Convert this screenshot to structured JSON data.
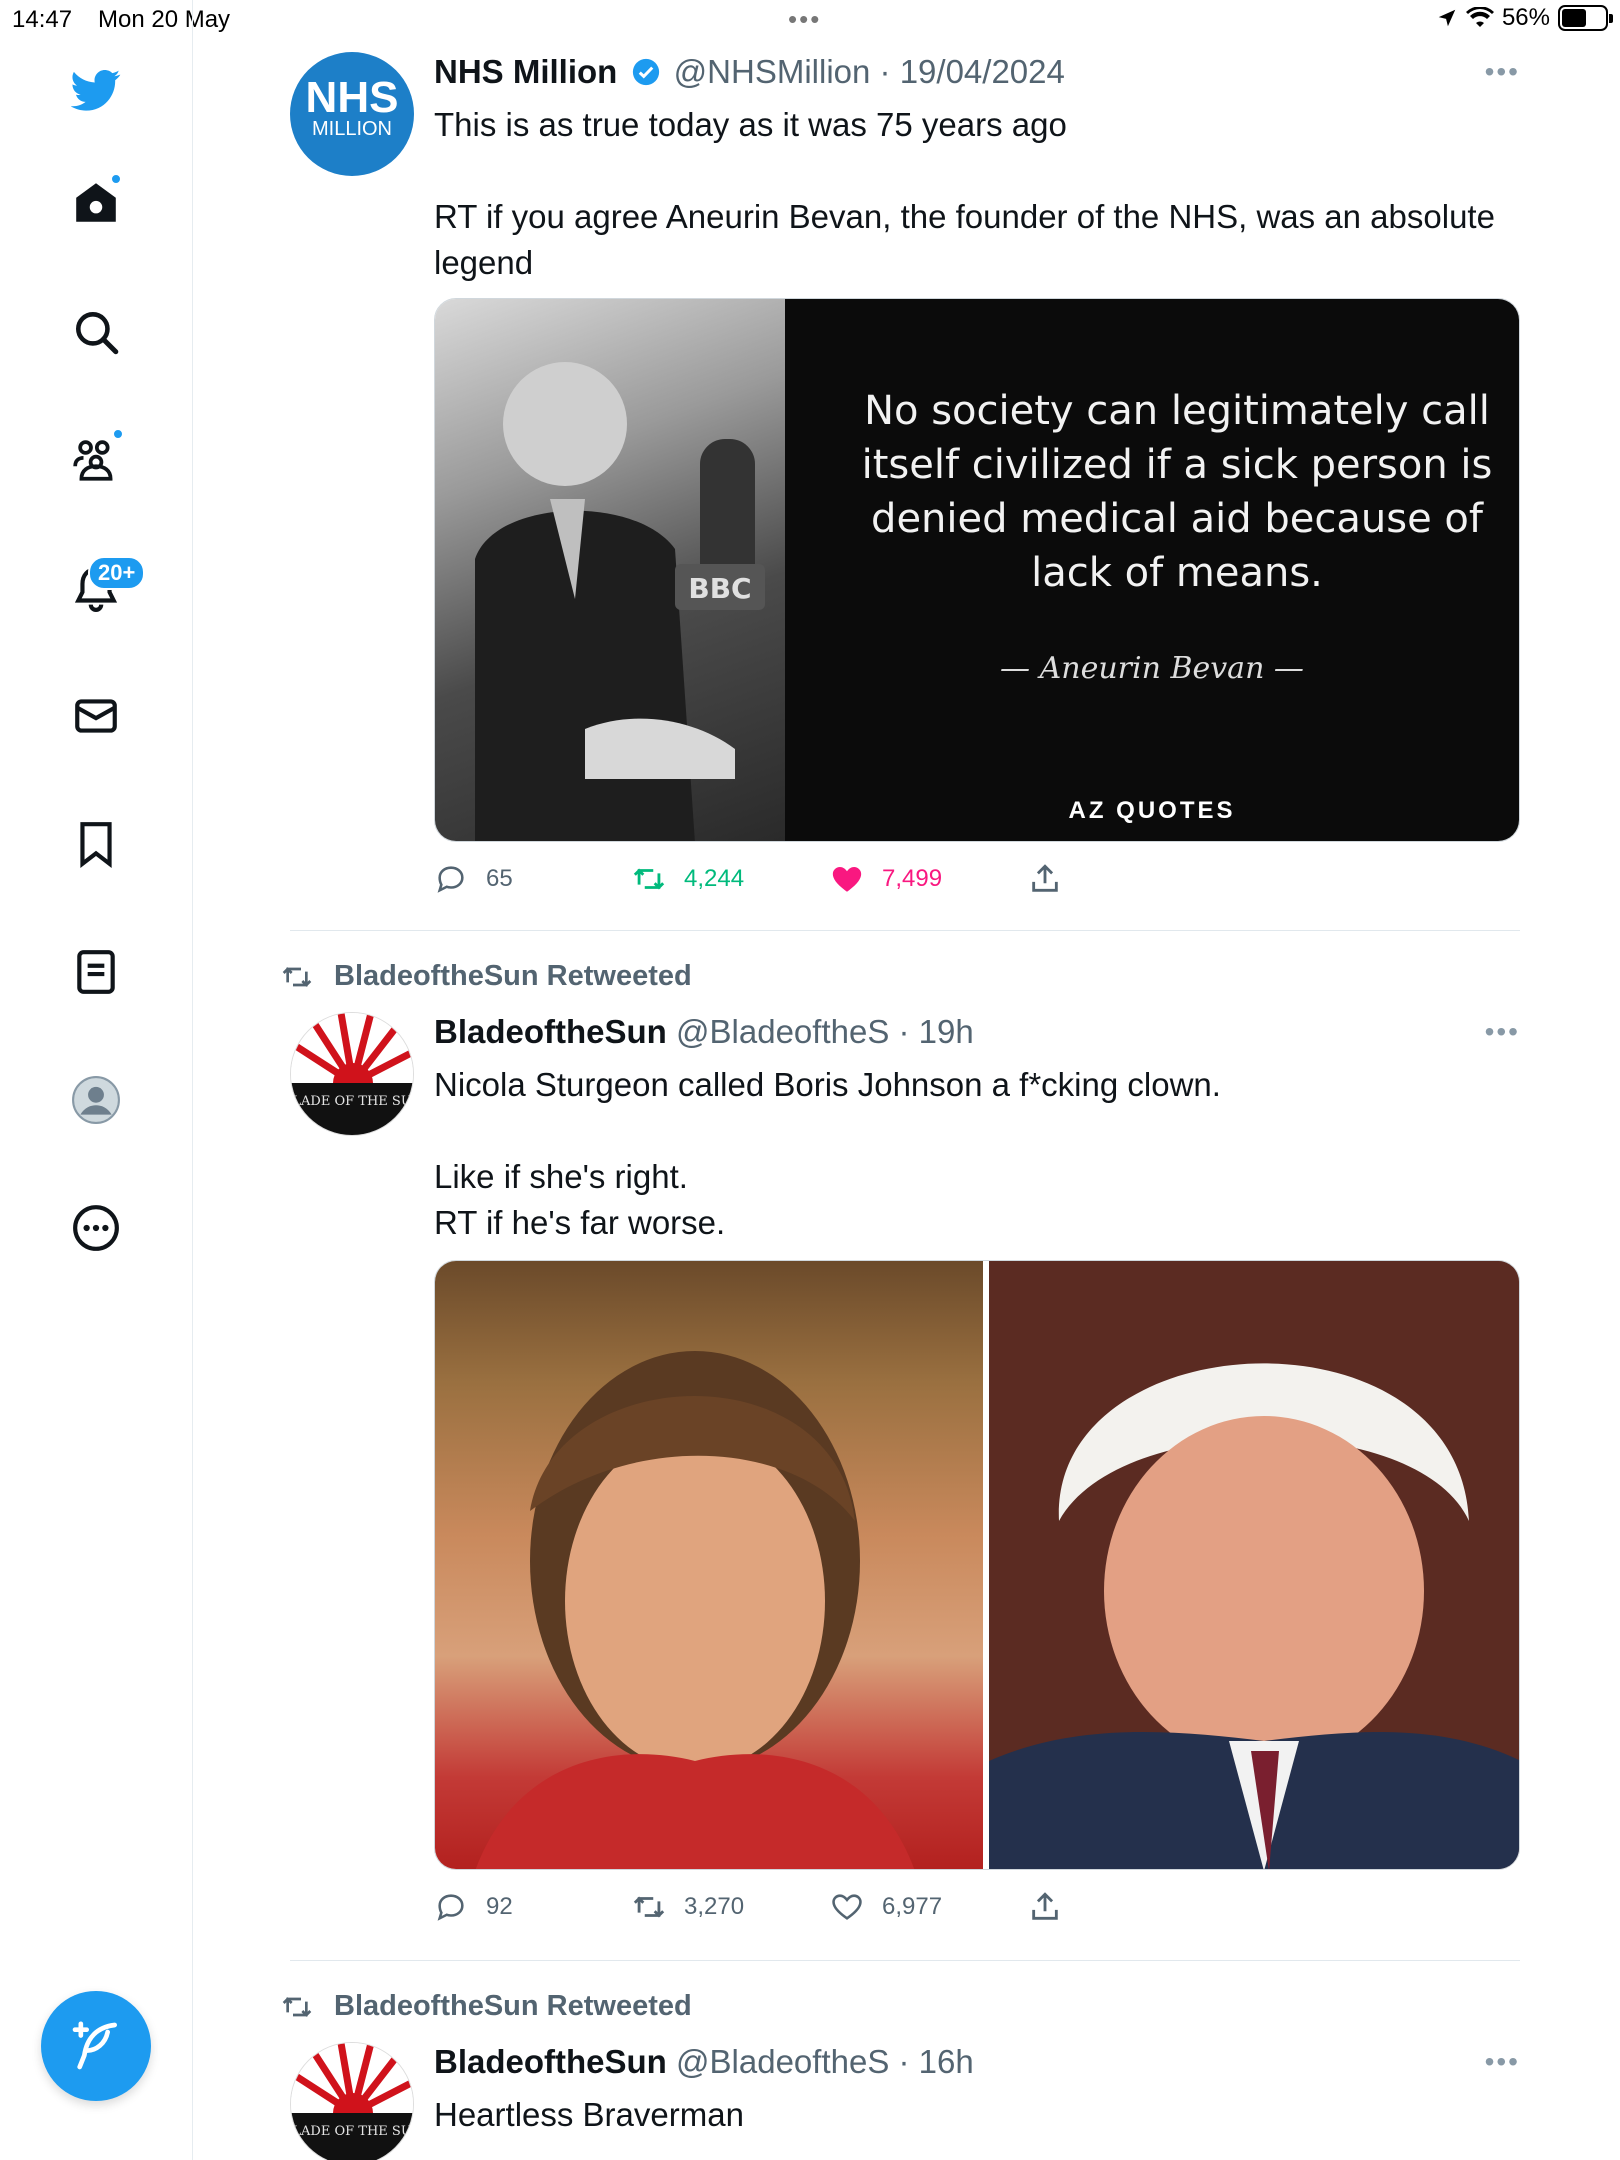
{
  "status_bar": {
    "time": "14:47",
    "date": "Mon 20 May",
    "battery": "56%",
    "battery_level": 0.56
  },
  "nav": {
    "items": [
      {
        "name": "twitter-logo-icon"
      },
      {
        "name": "home-icon"
      },
      {
        "name": "search-icon"
      },
      {
        "name": "communities-icon"
      },
      {
        "name": "notifications-icon"
      },
      {
        "name": "messages-icon"
      },
      {
        "name": "bookmarks-icon"
      },
      {
        "name": "lists-icon"
      },
      {
        "name": "profile-icon"
      },
      {
        "name": "more-icon"
      }
    ],
    "notifications_badge": "20+",
    "accent": "#1d9bf0"
  },
  "tweets": [
    {
      "avatar_line1": "NHS",
      "avatar_line2": "MILLION",
      "name": "NHS Million",
      "handle": "@NHSMillion",
      "time": "· 19/04/2024",
      "text": "This is as true today as it was 75 years ago\n\nRT if you agree Aneurin Bevan, the founder of the NHS, was an absolute legend",
      "media": {
        "quote": "No society can legitimately call itself civilized if a sick person is denied medical aid because of lack of means.",
        "author": "— Aneurin Bevan —",
        "brand": "AZ QUOTES",
        "mic_label": "BBC"
      },
      "replies": "65",
      "retweets": "4,244",
      "likes": "7,499",
      "liked": true,
      "retweeted": true
    },
    {
      "retweeted_by": "BladeoftheSun Retweeted",
      "avatar_text": "BLADE OF THE SUN",
      "name": "BladeoftheSun",
      "handle": "@BladeoftheS",
      "time": "· 19h",
      "text": "Nicola Sturgeon called Boris Johnson a f*cking clown.\n\nLike if she's right.\nRT if he's far worse.",
      "replies": "92",
      "retweets": "3,270",
      "likes": "6,977"
    },
    {
      "retweeted_by": "BladeoftheSun Retweeted",
      "avatar_text": "BLADE OF THE SUN",
      "name": "BladeoftheSun",
      "handle": "@BladeoftheS",
      "time": "· 16h",
      "text": "Heartless Braverman"
    }
  ]
}
